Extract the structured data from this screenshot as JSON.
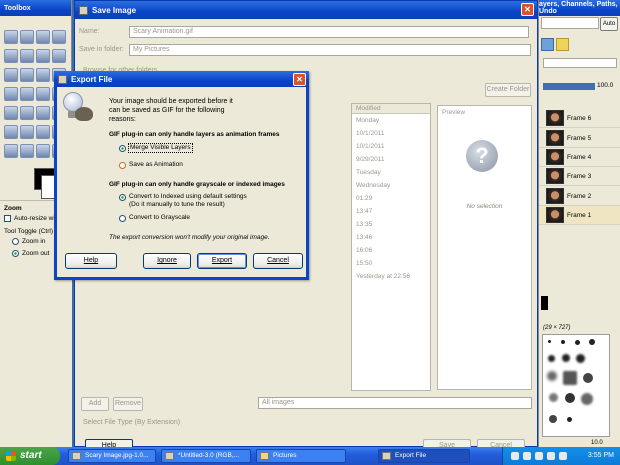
{
  "toolbox": {
    "title": "Toolbox",
    "options_title": "Zoom",
    "auto_resize": "Auto-resize win",
    "tool_toggle": "Tool Toggle (Ctrl)",
    "zoom_in": "Zoom in",
    "zoom_out": "Zoom out"
  },
  "dock": {
    "title": "ayers, Channels, Paths, Undo",
    "auto_button": "Auto",
    "opacity": "100.0",
    "brush_caption": "(29 × 727)",
    "spacing": "10.0",
    "layers": [
      {
        "name": "Frame 6"
      },
      {
        "name": "Frame 5"
      },
      {
        "name": "Frame 4"
      },
      {
        "name": "Frame 3"
      },
      {
        "name": "Frame 2"
      },
      {
        "name": "Frame 1"
      }
    ]
  },
  "save_window": {
    "title": "Save Image",
    "name_label": "Name:",
    "name_value": "Scary Animation.gif",
    "folder_label": "Save in folder:",
    "folder_value": "My Pictures",
    "browse_label": "Browse for other folders",
    "create_folder": "Create Folder",
    "modified_header": "Modified",
    "modified_items": [
      "Monday",
      "10/1/2011",
      "10/1/2011",
      "9/29/2011",
      "Tuesday",
      "Wednesday",
      "01:29",
      "13:47",
      "13:35",
      "13:46",
      "16:06",
      "15:50",
      "Yesterday at 22:56"
    ],
    "preview_label": "Preview",
    "no_selection": "No selection",
    "add_button": "Add",
    "remove_button": "Remove",
    "filter_value": "All images",
    "file_type_label": "Select File Type (By Extension)",
    "help_button": "Help",
    "save_button": "Save",
    "cancel_button": "Cancel"
  },
  "export_dialog": {
    "title": "Export File",
    "intro_line1": "Your image should be exported before it",
    "intro_line2": "can be saved as GIF for the following",
    "intro_line3": "reasons:",
    "layers_heading": "GIF plug-in can only handle layers as animation frames",
    "merge_option": "Merge Visible Layers",
    "animation_option": "Save as Animation",
    "indexed_heading": "GIF plug-in can only handle grayscale or indexed images",
    "indexed_option_line1": "Convert to Indexed using default settings",
    "indexed_option_line2": "(Do it manually to tune the result)",
    "grayscale_option": "Convert to Grayscale",
    "note": "The export conversion won't modify your original image.",
    "help_button": "Help",
    "ignore_button": "Ignore",
    "export_button": "Export",
    "cancel_button": "Cancel"
  },
  "taskbar": {
    "start_label": "start",
    "tasks": [
      {
        "label": "Scary Image.jpg-1.0..."
      },
      {
        "label": "*Untitled-3.0 (RGB,..."
      },
      {
        "label": "Pictures"
      },
      {
        "label": "Export File"
      }
    ],
    "clock": "3:55 PM"
  }
}
